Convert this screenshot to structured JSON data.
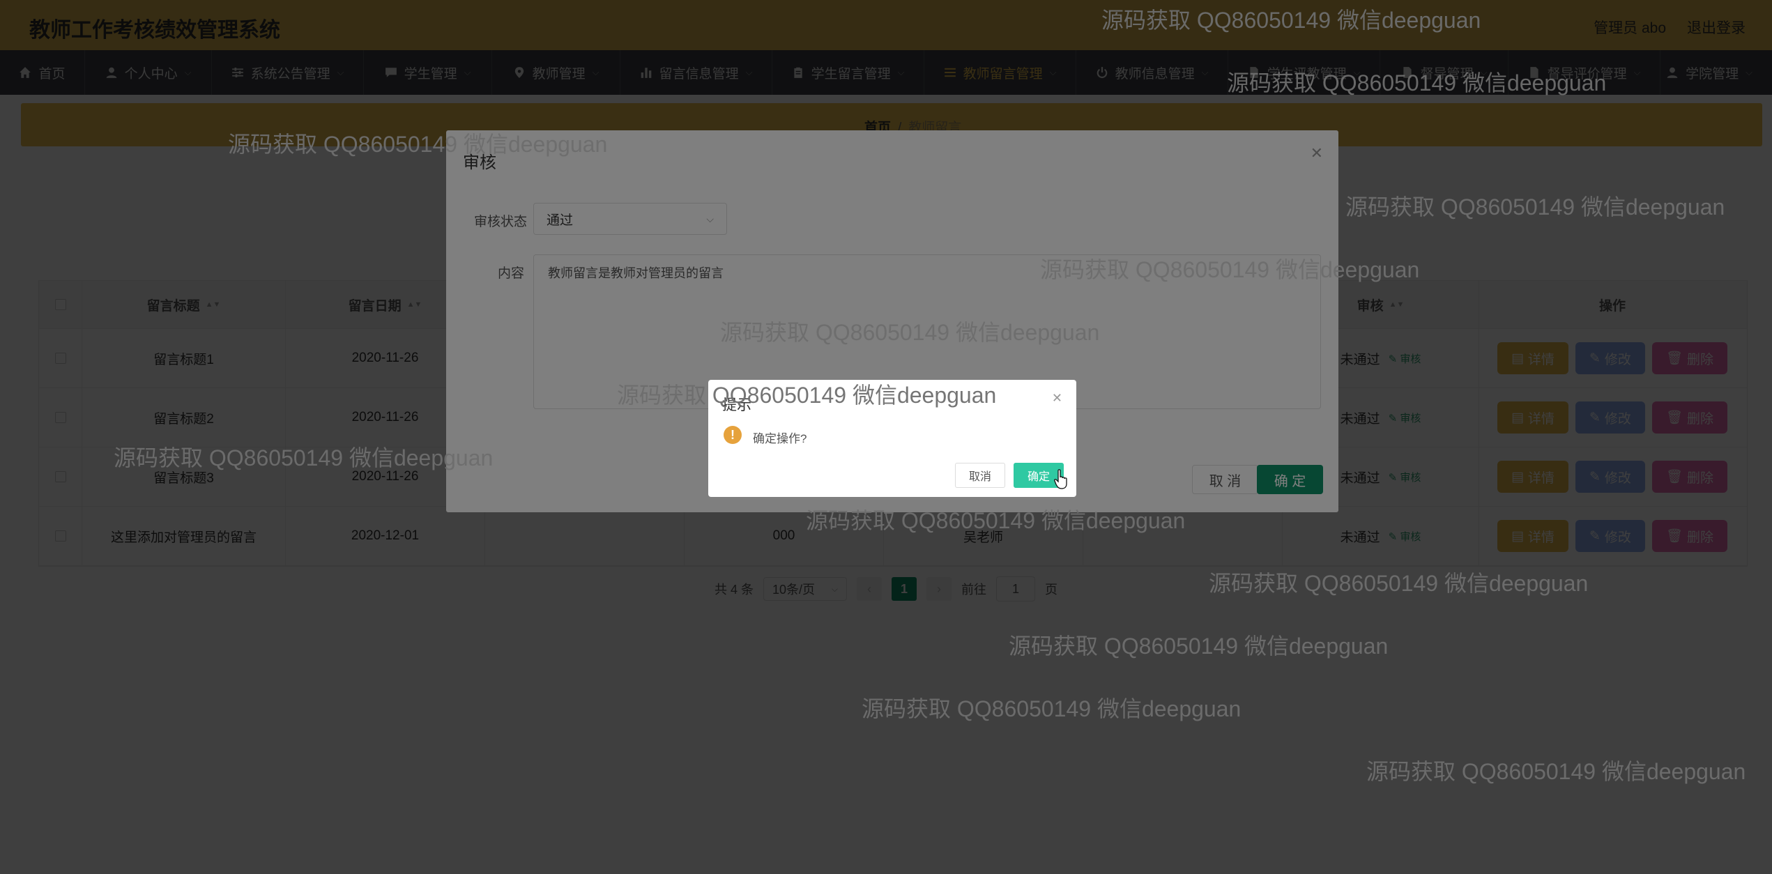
{
  "header": {
    "title": "教师工作考核绩效管理系统",
    "user": "管理员 abo",
    "logout": "退出登录"
  },
  "nav": [
    {
      "label": "首页",
      "icon": "home-icon"
    },
    {
      "label": "个人中心",
      "icon": "user-icon"
    },
    {
      "label": "系统公告管理",
      "icon": "sliders-icon"
    },
    {
      "label": "学生管理",
      "icon": "chat-icon"
    },
    {
      "label": "教师管理",
      "icon": "location-icon"
    },
    {
      "label": "留言信息管理",
      "icon": "bar-chart-icon"
    },
    {
      "label": "学生留言管理",
      "icon": "clipboard-icon"
    },
    {
      "label": "教师留言管理",
      "icon": "list-icon",
      "active": true
    },
    {
      "label": "教师信息管理",
      "icon": "power-icon"
    },
    {
      "label": "学生评教管理",
      "icon": "document-icon"
    },
    {
      "label": "督导管理",
      "icon": "document-icon"
    },
    {
      "label": "督导评价管理",
      "icon": "document-icon"
    },
    {
      "label": "学院管理",
      "icon": "user-icon"
    }
  ],
  "breadcrumb": {
    "home": "首页",
    "sep": "/",
    "current": "教师留言"
  },
  "table": {
    "columns": [
      "留言标题",
      "留言日期",
      "",
      "",
      "",
      "",
      "审核",
      "操作"
    ],
    "rows": [
      {
        "title": "留言标题1",
        "date": "2020-11-26",
        "c3": "",
        "c4": "",
        "c5": "",
        "c6": "",
        "status": "未通过"
      },
      {
        "title": "留言标题2",
        "date": "2020-11-26",
        "c3": "",
        "c4": "",
        "c5": "",
        "c6": "",
        "status": "未通过"
      },
      {
        "title": "留言标题3",
        "date": "2020-11-26",
        "c3": "",
        "c4": "",
        "c5": "",
        "c6": "",
        "status": "未通过"
      },
      {
        "title": "这里添加对管理员的留言",
        "date": "2020-12-01",
        "c3": "",
        "c4": "000",
        "c5": "吴老师",
        "c6": "",
        "status": "未通过"
      }
    ],
    "audit_link": "审核",
    "btn_detail": "详情",
    "btn_edit": "修改",
    "btn_delete": "删除"
  },
  "pagination": {
    "total": "共 4 条",
    "page_size": "10条/页",
    "current": "1",
    "goto_prefix": "前往",
    "goto_value": "1",
    "goto_suffix": "页"
  },
  "audit_dialog": {
    "title": "审核",
    "status_label": "审核状态",
    "status_value": "通过",
    "content_label": "内容",
    "content_value": "教师留言是教师对管理员的留言",
    "cancel": "取 消",
    "confirm": "确 定"
  },
  "confirm_dialog": {
    "title": "提示",
    "message": "确定操作?",
    "cancel": "取消",
    "confirm": "确定"
  },
  "watermark": "源码获取 QQ86050149 微信deepguan",
  "colors": {
    "header": "#d8b04c",
    "nav": "#3c3f44",
    "accent": "#e9bf4d",
    "primary": "#0f8f66",
    "confirm": "#2fc9a2"
  }
}
